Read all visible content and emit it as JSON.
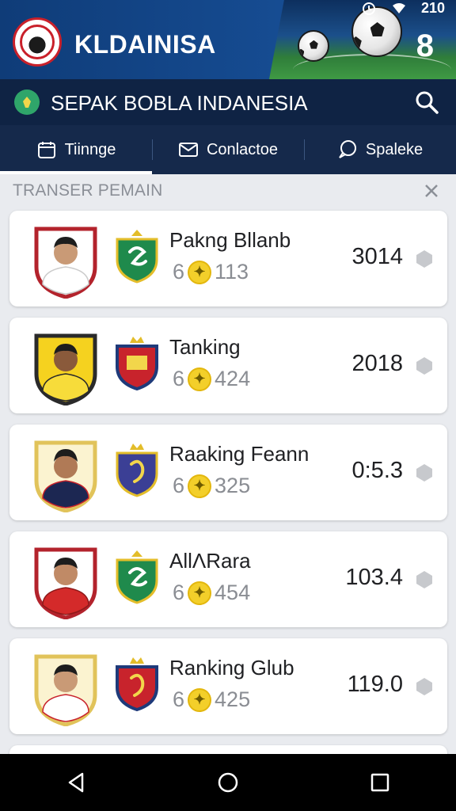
{
  "app": {
    "title": "KLDAINISA",
    "header_count": "8",
    "status_value": "210"
  },
  "search": {
    "title": "SEPAK BOBLA INDANESIA"
  },
  "tabs": [
    {
      "label": "Tiinnge",
      "icon": "calendar-icon",
      "active": true
    },
    {
      "label": "Conlactoe",
      "icon": "mail-icon",
      "active": false
    },
    {
      "label": "Spaleke",
      "icon": "chat-icon",
      "active": false
    }
  ],
  "section": {
    "title": "TRANSER PEMAIN"
  },
  "players": [
    {
      "name": "Pakng Bllanb",
      "rank": "6",
      "points": "113",
      "value": "3014",
      "badge_color": "#b3232c",
      "kit_color": "#ffffff",
      "crest": "green"
    },
    {
      "name": "Tanking",
      "rank": "6",
      "points": "424",
      "value": "2018",
      "badge_color": "#2a2a2a",
      "kit_color": "#f5d21f",
      "crest": "red"
    },
    {
      "name": "Raaking Feann",
      "rank": "6",
      "points": "325",
      "value": "0:5.3",
      "badge_color": "#e1c35a",
      "kit_color": "#1c2752",
      "crest": "purple"
    },
    {
      "name": "AllΛRara",
      "rank": "6",
      "points": "454",
      "value": "103.4",
      "badge_color": "#b3232c",
      "kit_color": "#d42a2a",
      "crest": "green"
    },
    {
      "name": "Ranking Glub",
      "rank": "6",
      "points": "425",
      "value": "119.0",
      "badge_color": "#e1c35a",
      "kit_color": "#ffffff",
      "crest": "red"
    }
  ],
  "colors": {
    "header": "#154a8f",
    "searchbar": "#0f2344",
    "tabs": "#15294b",
    "coin": "#f3cf2a"
  }
}
